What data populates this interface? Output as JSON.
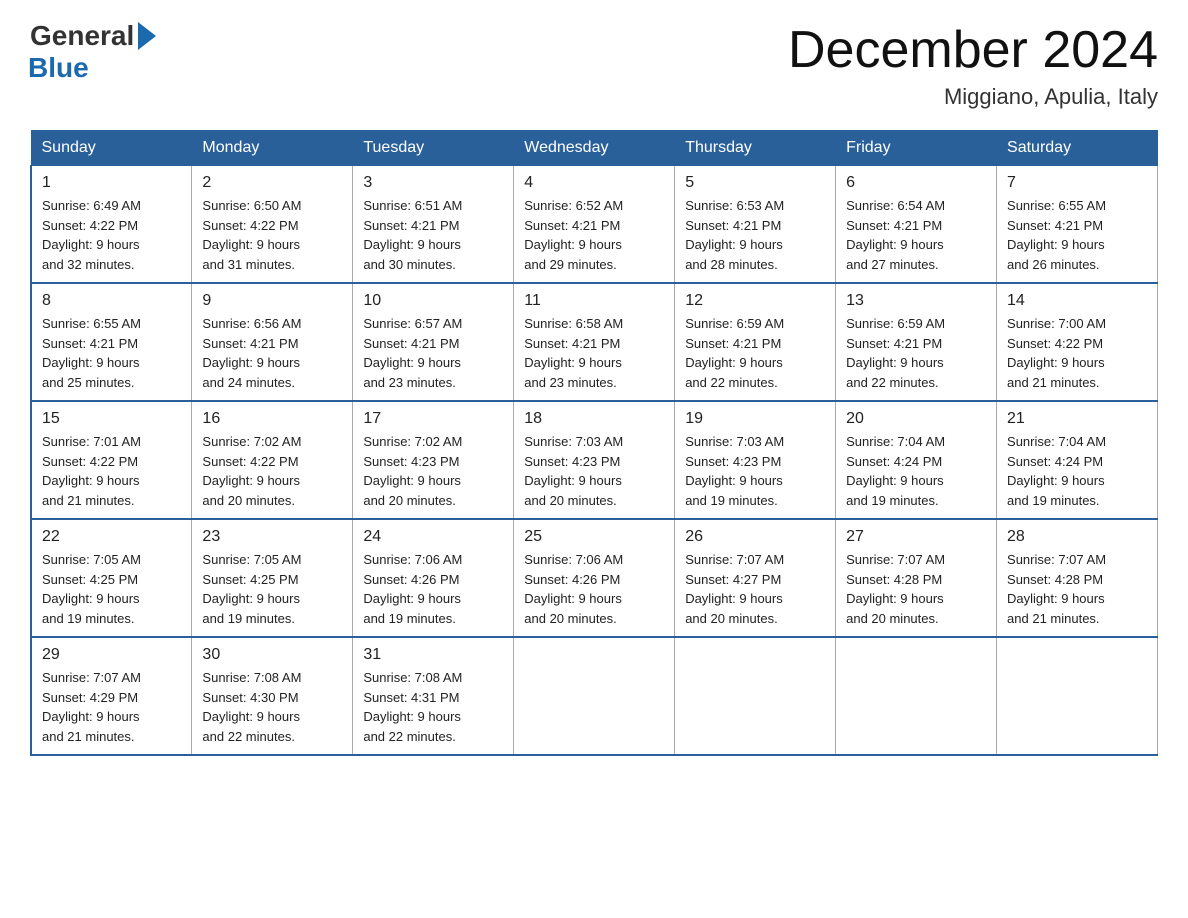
{
  "header": {
    "logo_general": "General",
    "logo_blue": "Blue",
    "month_title": "December 2024",
    "location": "Miggiano, Apulia, Italy"
  },
  "days_of_week": [
    "Sunday",
    "Monday",
    "Tuesday",
    "Wednesday",
    "Thursday",
    "Friday",
    "Saturday"
  ],
  "weeks": [
    [
      {
        "num": "1",
        "sunrise": "6:49 AM",
        "sunset": "4:22 PM",
        "daylight": "9 hours and 32 minutes."
      },
      {
        "num": "2",
        "sunrise": "6:50 AM",
        "sunset": "4:22 PM",
        "daylight": "9 hours and 31 minutes."
      },
      {
        "num": "3",
        "sunrise": "6:51 AM",
        "sunset": "4:21 PM",
        "daylight": "9 hours and 30 minutes."
      },
      {
        "num": "4",
        "sunrise": "6:52 AM",
        "sunset": "4:21 PM",
        "daylight": "9 hours and 29 minutes."
      },
      {
        "num": "5",
        "sunrise": "6:53 AM",
        "sunset": "4:21 PM",
        "daylight": "9 hours and 28 minutes."
      },
      {
        "num": "6",
        "sunrise": "6:54 AM",
        "sunset": "4:21 PM",
        "daylight": "9 hours and 27 minutes."
      },
      {
        "num": "7",
        "sunrise": "6:55 AM",
        "sunset": "4:21 PM",
        "daylight": "9 hours and 26 minutes."
      }
    ],
    [
      {
        "num": "8",
        "sunrise": "6:55 AM",
        "sunset": "4:21 PM",
        "daylight": "9 hours and 25 minutes."
      },
      {
        "num": "9",
        "sunrise": "6:56 AM",
        "sunset": "4:21 PM",
        "daylight": "9 hours and 24 minutes."
      },
      {
        "num": "10",
        "sunrise": "6:57 AM",
        "sunset": "4:21 PM",
        "daylight": "9 hours and 23 minutes."
      },
      {
        "num": "11",
        "sunrise": "6:58 AM",
        "sunset": "4:21 PM",
        "daylight": "9 hours and 23 minutes."
      },
      {
        "num": "12",
        "sunrise": "6:59 AM",
        "sunset": "4:21 PM",
        "daylight": "9 hours and 22 minutes."
      },
      {
        "num": "13",
        "sunrise": "6:59 AM",
        "sunset": "4:21 PM",
        "daylight": "9 hours and 22 minutes."
      },
      {
        "num": "14",
        "sunrise": "7:00 AM",
        "sunset": "4:22 PM",
        "daylight": "9 hours and 21 minutes."
      }
    ],
    [
      {
        "num": "15",
        "sunrise": "7:01 AM",
        "sunset": "4:22 PM",
        "daylight": "9 hours and 21 minutes."
      },
      {
        "num": "16",
        "sunrise": "7:02 AM",
        "sunset": "4:22 PM",
        "daylight": "9 hours and 20 minutes."
      },
      {
        "num": "17",
        "sunrise": "7:02 AM",
        "sunset": "4:23 PM",
        "daylight": "9 hours and 20 minutes."
      },
      {
        "num": "18",
        "sunrise": "7:03 AM",
        "sunset": "4:23 PM",
        "daylight": "9 hours and 20 minutes."
      },
      {
        "num": "19",
        "sunrise": "7:03 AM",
        "sunset": "4:23 PM",
        "daylight": "9 hours and 19 minutes."
      },
      {
        "num": "20",
        "sunrise": "7:04 AM",
        "sunset": "4:24 PM",
        "daylight": "9 hours and 19 minutes."
      },
      {
        "num": "21",
        "sunrise": "7:04 AM",
        "sunset": "4:24 PM",
        "daylight": "9 hours and 19 minutes."
      }
    ],
    [
      {
        "num": "22",
        "sunrise": "7:05 AM",
        "sunset": "4:25 PM",
        "daylight": "9 hours and 19 minutes."
      },
      {
        "num": "23",
        "sunrise": "7:05 AM",
        "sunset": "4:25 PM",
        "daylight": "9 hours and 19 minutes."
      },
      {
        "num": "24",
        "sunrise": "7:06 AM",
        "sunset": "4:26 PM",
        "daylight": "9 hours and 19 minutes."
      },
      {
        "num": "25",
        "sunrise": "7:06 AM",
        "sunset": "4:26 PM",
        "daylight": "9 hours and 20 minutes."
      },
      {
        "num": "26",
        "sunrise": "7:07 AM",
        "sunset": "4:27 PM",
        "daylight": "9 hours and 20 minutes."
      },
      {
        "num": "27",
        "sunrise": "7:07 AM",
        "sunset": "4:28 PM",
        "daylight": "9 hours and 20 minutes."
      },
      {
        "num": "28",
        "sunrise": "7:07 AM",
        "sunset": "4:28 PM",
        "daylight": "9 hours and 21 minutes."
      }
    ],
    [
      {
        "num": "29",
        "sunrise": "7:07 AM",
        "sunset": "4:29 PM",
        "daylight": "9 hours and 21 minutes."
      },
      {
        "num": "30",
        "sunrise": "7:08 AM",
        "sunset": "4:30 PM",
        "daylight": "9 hours and 22 minutes."
      },
      {
        "num": "31",
        "sunrise": "7:08 AM",
        "sunset": "4:31 PM",
        "daylight": "9 hours and 22 minutes."
      },
      null,
      null,
      null,
      null
    ]
  ],
  "labels": {
    "sunrise": "Sunrise:",
    "sunset": "Sunset:",
    "daylight": "Daylight:"
  }
}
